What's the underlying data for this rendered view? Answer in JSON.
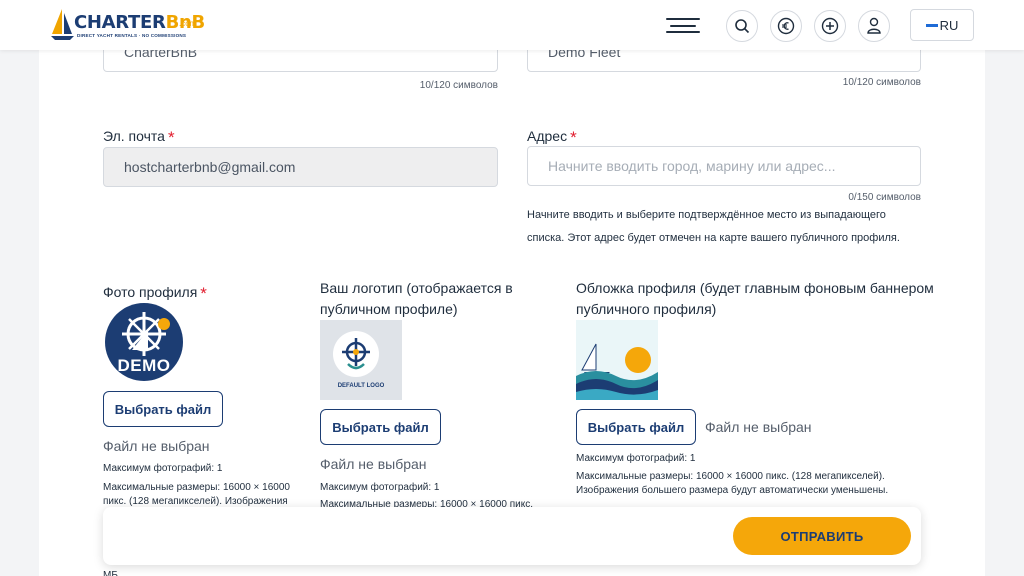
{
  "header": {
    "logo_word_main": "CHARTER",
    "logo_word_accent": "BnB",
    "logo_domain": ".com",
    "logo_tagline": "DIRECT YACHT RENTALS · NO COMMISSIONS",
    "lang_label": "RU",
    "icons": [
      "menu-icon",
      "search-icon",
      "euro-icon",
      "plus-circle-icon",
      "user-icon"
    ]
  },
  "form": {
    "name": {
      "value": "CharterBnB",
      "counter": "10/120 символов"
    },
    "fleet": {
      "value": "Demo Fleet",
      "counter": "10/120 символов"
    },
    "email": {
      "label": "Эл. почта",
      "required": "*",
      "value": "hostcharterbnb@gmail.com"
    },
    "address": {
      "label": "Адрес",
      "required": "*",
      "placeholder": "Начните вводить город, марину или адрес...",
      "counter": "0/150 символов",
      "help_1": "Начните вводить и выберите подтверждённое место из выпадающего",
      "help_2": "списка. Этот адрес будет отмечен на карте вашего публичного профиля."
    },
    "profile_photo": {
      "label": "Фото профиля",
      "required": "*",
      "image_text": "DEMO",
      "button": "Выбрать файл",
      "no_file": "Файл не выбран",
      "max_photos": "Максимум фотографий: 1",
      "max_size_1": "Максимальные размеры: 16000 × 16000",
      "max_size_2": "пикс. (128 мегапикселей). Изображения"
    },
    "logo": {
      "label_1": "Ваш логотип (отображается в",
      "label_2": "публичном профиле)",
      "image_text": "DEFAULT LOGO",
      "button": "Выбрать файл",
      "no_file": "Файл не выбран",
      "max_photos": "Максимум фотографий: 1",
      "max_size_1": "Максимальные размеры: 16000 × 16000 пикс."
    },
    "cover": {
      "label_1": "Обложка профиля (будет главным фоновым баннером",
      "label_2": "публичного профиля)",
      "button": "Выбрать файл",
      "no_file": "Файл не выбран",
      "max_photos": "Максимум фотографий: 1",
      "max_size_1": "Максимальные размеры: 16000 × 16000 пикс. (128 мегапикселей).",
      "max_size_2": "Изображения большего размера будут автоматически уменьшены."
    },
    "cutoff_text": "МБ",
    "submit_label": "ОТПРАВИТЬ"
  },
  "colors": {
    "navy": "#1c3d73",
    "accent": "#f5a70a",
    "required": "#e11d2e"
  }
}
